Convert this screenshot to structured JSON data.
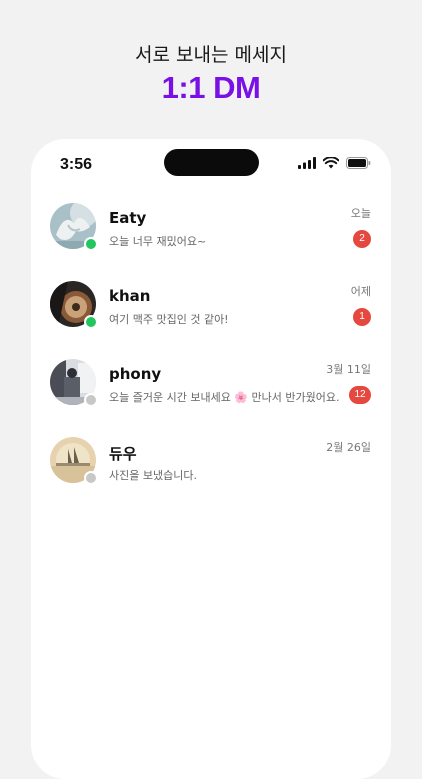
{
  "promo": {
    "subtitle": "서로 보내는 메세지",
    "title": "1:1 DM"
  },
  "status_bar": {
    "time": "3:56"
  },
  "colors": {
    "accent": "#7a10e6",
    "online": "#22c55e",
    "offline": "#c8c8c8",
    "badge": "#e5483f"
  },
  "conversations": [
    {
      "name": "Eaty",
      "preview": "오늘 너무 재밌어요~",
      "time": "오늘",
      "unread": "2",
      "status": "online"
    },
    {
      "name": "khan",
      "preview": "여기 맥주 맛집인 것 같아!",
      "time": "어제",
      "unread": "1",
      "status": "online"
    },
    {
      "name": "phony",
      "preview": "오늘 즐거운 시간 보내세요 🌸 만나서 반가웠어요...",
      "time": "3월 11일",
      "unread": "12",
      "status": "offline"
    },
    {
      "name": "듀우",
      "preview": "사진을 보냈습니다.",
      "time": "2월 26일",
      "unread": "",
      "status": "offline"
    }
  ]
}
